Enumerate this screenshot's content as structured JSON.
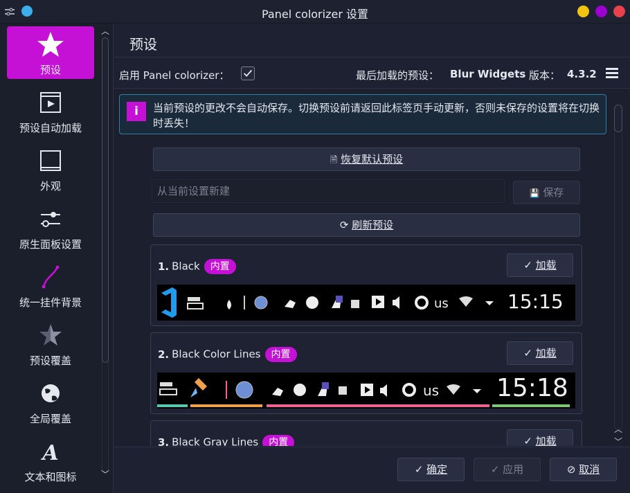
{
  "window": {
    "title": "Panel colorizer 设置"
  },
  "colors": {
    "accent": "#c510d6",
    "titlebar_yellow": "#f1c40f",
    "titlebar_purple": "#9b00d0",
    "titlebar_red": "#e8414b",
    "line_teal": "#56c8b0",
    "line_orange": "#f0a04b",
    "line_pink": "#f06292",
    "line_green": "#7cc876"
  },
  "sidebar": {
    "items": [
      {
        "label": "预设",
        "icon": "star-icon",
        "active": true
      },
      {
        "label": "预设自动加载",
        "icon": "play-window-icon"
      },
      {
        "label": "外观",
        "icon": "window-frame-icon"
      },
      {
        "label": "原生面板设置",
        "icon": "sliders-icon"
      },
      {
        "label": "统一挂件背景",
        "icon": "curve-icon"
      },
      {
        "label": "预设覆盖",
        "icon": "star-outline-icon"
      },
      {
        "label": "全局覆盖",
        "icon": "globe-icon"
      },
      {
        "label": "文本和图标",
        "icon": "font-icon"
      }
    ]
  },
  "main": {
    "title": "预设",
    "enable_label": "启用 Panel colorizer：",
    "enabled": true,
    "last_loaded_label": "最后加载的预设：",
    "last_loaded_value": "Blur Widgets",
    "version_label": "版本：",
    "version_value": "4.3.2",
    "notice": "当前预设的更改不会自动保存。切换预设前请返回此标签页手动更新，否则未保存的设置将在切换时丢失！",
    "restore_button": "恢复默认预设",
    "new_placeholder": "从当前设置新建",
    "save_button": "保存",
    "refresh_button": "刷新预设",
    "presets": [
      {
        "index": "1.",
        "name": "Black",
        "badge": "内置",
        "load_label": "加载",
        "clock": "15:15",
        "lang": "us"
      },
      {
        "index": "2.",
        "name": "Black Color Lines",
        "badge": "内置",
        "load_label": "加载",
        "clock": "15:18",
        "lang": "us"
      },
      {
        "index": "3.",
        "name": "Black Gray Lines",
        "badge": "内置",
        "load_label": "加载"
      }
    ]
  },
  "footer": {
    "ok": "确定",
    "apply": "应用",
    "cancel": "取消"
  }
}
